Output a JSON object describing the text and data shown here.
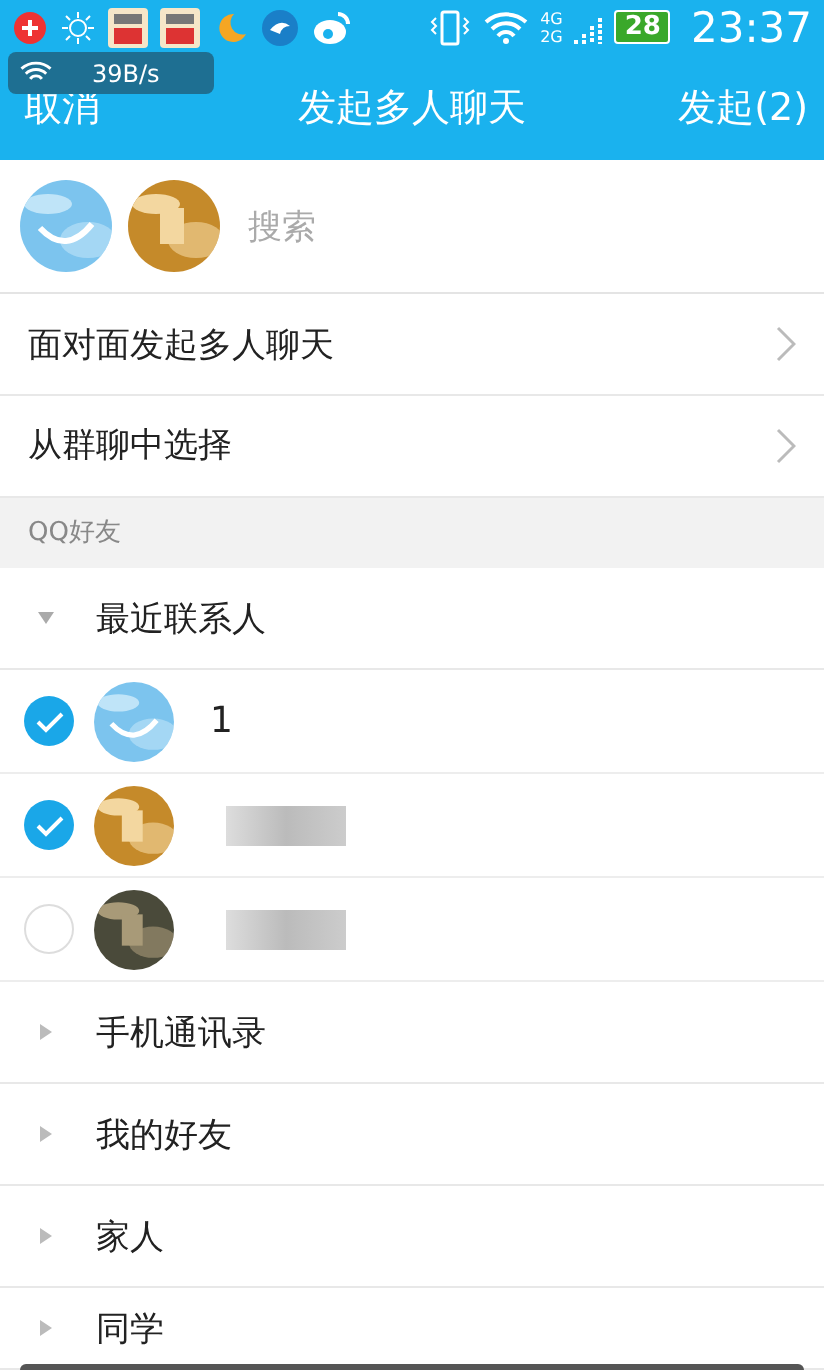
{
  "status_bar": {
    "notification_icons": [
      {
        "kind": "plus"
      },
      {
        "kind": "sun"
      },
      {
        "kind": "app"
      },
      {
        "kind": "app"
      },
      {
        "kind": "moon"
      },
      {
        "kind": "bird"
      },
      {
        "kind": "weibo"
      }
    ],
    "network_labels": [
      "4G",
      "2G"
    ],
    "battery": "28",
    "time": "23:37"
  },
  "speed_widget": {
    "value": "39B/s"
  },
  "header": {
    "cancel": "取消",
    "title": "发起多人聊天",
    "confirm": "发起(2)"
  },
  "search": {
    "placeholder": "搜索",
    "selected_avatars": [
      {
        "kind": "sky"
      },
      {
        "kind": "toy"
      }
    ]
  },
  "menu_items": [
    {
      "label": "面对面发起多人聊天"
    },
    {
      "label": "从群聊中选择"
    }
  ],
  "section": {
    "title": "QQ好友"
  },
  "groups": [
    {
      "label": "最近联系人",
      "expanded": true,
      "children": [
        {
          "name": "1",
          "selected": true,
          "avatar": {
            "kind": "sky"
          }
        },
        {
          "selected": true,
          "avatar": {
            "kind": "toy"
          }
        },
        {
          "selected": false,
          "avatar": {
            "kind": "dark"
          }
        }
      ]
    },
    {
      "label": "手机通讯录",
      "expanded": false
    },
    {
      "label": "我的好友",
      "expanded": false
    },
    {
      "label": "家人",
      "expanded": false
    },
    {
      "label": "同学",
      "expanded": false
    }
  ]
}
